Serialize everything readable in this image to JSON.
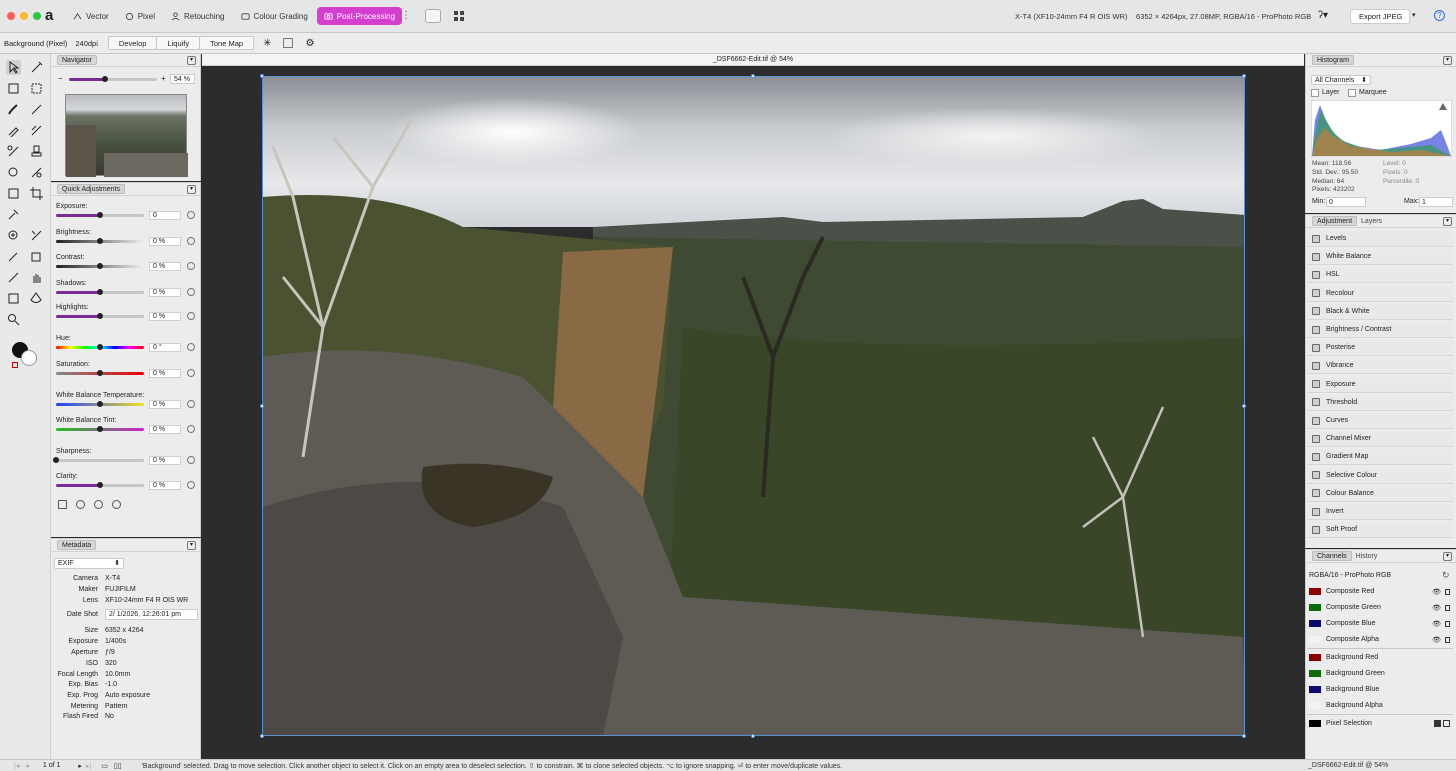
{
  "titlebar": {
    "personas": [
      {
        "label": "Vector",
        "icon": "vector-persona-icon"
      },
      {
        "label": "Pixel",
        "icon": "pixel-persona-icon"
      },
      {
        "label": "Retouching",
        "icon": "retouching-persona-icon"
      },
      {
        "label": "Colour Grading",
        "icon": "colour-grading-persona-icon"
      },
      {
        "label": "Post-Processing",
        "icon": "post-processing-persona-icon"
      }
    ],
    "camera_info": "X-T4 (XF10-24mm F4 R OIS WR)",
    "image_info": "6352 × 4264px, 27.08MP, RGBA/16 - ProPhoto RGB",
    "export_label": "Export JPEG",
    "accent": "#d43fd0"
  },
  "context": {
    "layer": "Background (Pixel)",
    "dpi": "240dpi",
    "tabs": [
      "Develop",
      "Liquify",
      "Tone Map"
    ]
  },
  "canvas": {
    "title": "_DSF6662-Edit.tif @ 54%"
  },
  "navigator": {
    "title": "Navigator",
    "zoom": "54 %",
    "minus": "−",
    "plus": "+"
  },
  "quick_adjustments": {
    "title": "Quick Adjustments",
    "items": [
      {
        "label": "Exposure:",
        "value": "0",
        "level": 0.5
      },
      {
        "label": "Brightness:",
        "value": "0 %",
        "level": 0.5
      },
      {
        "label": "Contrast:",
        "value": "0 %",
        "level": 0.5
      },
      {
        "label": "Shadows:",
        "value": "0 %",
        "level": 0.5
      },
      {
        "label": "Highlights:",
        "value": "0 %",
        "level": 0.5
      },
      {
        "label": "Hue:",
        "value": "0 °",
        "level": 0.5
      },
      {
        "label": "Saturation:",
        "value": "0 %",
        "level": 0.5
      },
      {
        "label": "White Balance Temperature:",
        "value": "0 %",
        "level": 0.5
      },
      {
        "label": "White Balance Tint:",
        "value": "0 %",
        "level": 0.5
      },
      {
        "label": "Sharpness:",
        "value": "0 %",
        "level": 0.0
      },
      {
        "label": "Clarity:",
        "value": "0 %",
        "level": 0.5
      }
    ]
  },
  "metadata": {
    "title": "Metadata",
    "preset": "EXIF",
    "rows": [
      {
        "k": "Camera",
        "v": "X-T4"
      },
      {
        "k": "Maker",
        "v": "FUJIFILM"
      },
      {
        "k": "Lens",
        "v": "XF10-24mm F4 R OIS WR"
      },
      {
        "k": "Date Shot",
        "v": "2/ 1/2026, 12:26:01 pm"
      },
      {
        "k": "Size",
        "v": "6352 x 4264"
      },
      {
        "k": "Exposure",
        "v": "1/400s"
      },
      {
        "k": "Aperture",
        "v": "ƒ/9"
      },
      {
        "k": "ISO",
        "v": "320"
      },
      {
        "k": "Focal Length",
        "v": "10.0mm"
      },
      {
        "k": "Exp. Bias",
        "v": "-1.0"
      },
      {
        "k": "Exp. Prog",
        "v": "Auto exposure"
      },
      {
        "k": "Metering",
        "v": "Pattern"
      },
      {
        "k": "Flash Fired",
        "v": "No"
      }
    ]
  },
  "histogram": {
    "title": "Histogram",
    "channels": "All Channels",
    "layer": "Layer",
    "marquee": "Marquee",
    "mean": "Mean: 118.56",
    "stddev": "Std. Dev.: 95.50",
    "median": "Median: 64",
    "pixels": "Pixels: 423202",
    "level": "Level: 0",
    "pixels2": "Pixels: 0",
    "percentile": "Percentile: 0",
    "min_label": "Min:",
    "min_val": "0",
    "max_label": "Max:",
    "max_val": "1"
  },
  "adjustments": {
    "tab_active": "Adjustment",
    "tab_other": "Layers",
    "items": [
      "Levels",
      "White Balance",
      "HSL",
      "Recolour",
      "Black & White",
      "Brightness / Contrast",
      "Posterise",
      "Vibrance",
      "Exposure",
      "Threshold",
      "Curves",
      "Channel Mixer",
      "Gradient Map",
      "Selective Colour",
      "Colour Balance",
      "Invert",
      "Soft Proof"
    ]
  },
  "channels": {
    "tab_active": "Channels",
    "tab_other": "History",
    "profile": "RGBA/16 - ProPhoto RGB",
    "composite": [
      {
        "name": "Composite Red",
        "color": "#8b0000"
      },
      {
        "name": "Composite Green",
        "color": "#0b6b0b"
      },
      {
        "name": "Composite Blue",
        "color": "#0a0a6e"
      },
      {
        "name": "Composite Alpha",
        "color": "#f2f2f2"
      }
    ],
    "background": [
      {
        "name": "Background Red",
        "color": "#8b0000"
      },
      {
        "name": "Background Green",
        "color": "#0b6b0b"
      },
      {
        "name": "Background Blue",
        "color": "#0a0a6e"
      },
      {
        "name": "Background Alpha",
        "color": "#f2f2f2"
      }
    ],
    "pixel_selection": "Pixel Selection"
  },
  "status": {
    "page": "1 of 1",
    "message": "'Background' selected. Drag to move selection. Click another object to select it. Click on an empty area to deselect selection. ⇧ to constrain. ⌘ to clone selected objects. ⌥ to ignore snapping. ⏎ to enter move/duplicate values.",
    "doc": "_DSF6662-Edit.tif @ 54%"
  }
}
